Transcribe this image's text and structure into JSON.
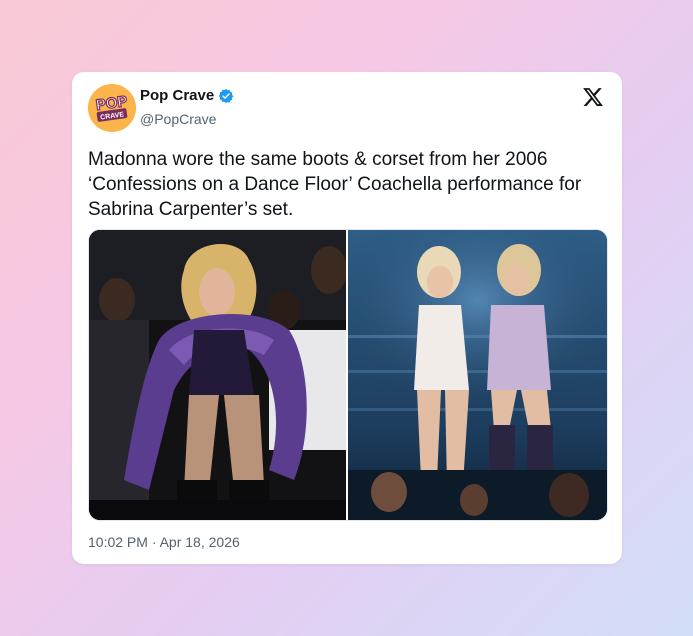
{
  "author": {
    "name": "Pop Crave",
    "handle": "@PopCrave",
    "verified": true,
    "avatar_text_top": "POP",
    "avatar_text_bottom": "CRAVE",
    "avatar_color": "#fbb44a"
  },
  "tweet": {
    "text": "Madonna wore the same boots & corset from her 2006 ‘Confessions on a Dance Floor’ Coachella performance for Sabrina Carpenter’s set.",
    "timestamp": "10:02 PM · Apr 18, 2026"
  },
  "media": {
    "left_photo": "photo-madonna-2006-performance",
    "right_photo": "photo-sabrina-carpenter-set"
  },
  "icons": {
    "platform_logo": "x-logo-icon",
    "verified_badge": "verified-badge-icon"
  },
  "colors": {
    "accent": "#1d9bf0",
    "text": "#0f1419",
    "muted": "#536471"
  }
}
